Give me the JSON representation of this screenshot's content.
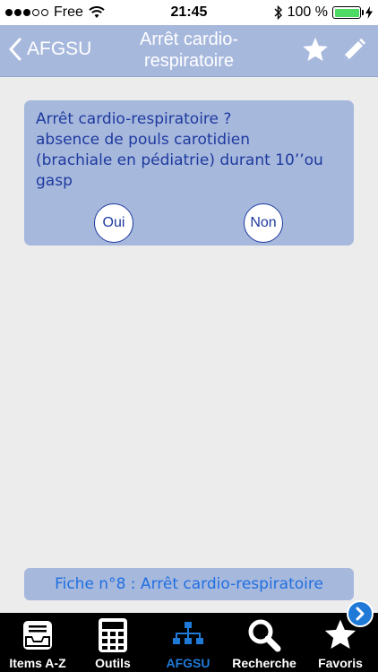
{
  "status_bar": {
    "carrier": "Free",
    "time": "21:45",
    "battery_label": "100 %",
    "battery_level": 1.0
  },
  "nav": {
    "back_label": "AFGSU",
    "title_line1": "Arrêt cardio-",
    "title_line2": "respiratoire"
  },
  "card": {
    "question_lines": [
      "Arrêt cardio-respiratoire ?",
      "absence de pouls carotidien",
      "(brachiale en pédiatrie) durant 10’’ou",
      "gasp"
    ],
    "yes_label": "Oui",
    "no_label": "Non"
  },
  "fiche": {
    "label": "Fiche n°8 : Arrêt cardio-respiratoire"
  },
  "tabs": [
    {
      "label": "Items A-Z",
      "icon": "inbox-tray-icon",
      "active": false
    },
    {
      "label": "Outils",
      "icon": "calculator-icon",
      "active": false
    },
    {
      "label": "AFGSU",
      "icon": "tree-diagram-icon",
      "active": true
    },
    {
      "label": "Recherche",
      "icon": "search-icon",
      "active": false
    },
    {
      "label": "Favoris",
      "icon": "star-icon",
      "active": false
    }
  ],
  "colors": {
    "accent_bar": "#a7b8dd",
    "text_blue": "#1e3a9e",
    "link_blue": "#1f6fe0",
    "tab_active": "#1f7ad7",
    "battery_green": "#4cd964"
  }
}
